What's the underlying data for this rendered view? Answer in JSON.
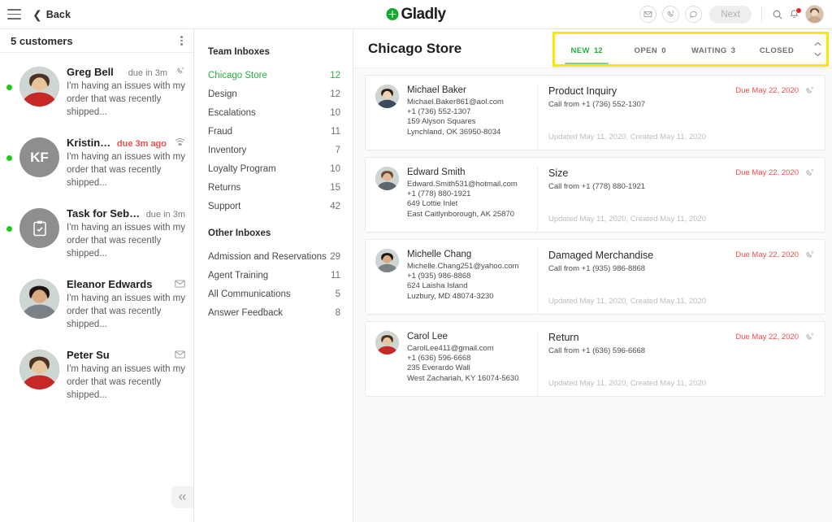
{
  "topbar": {
    "back_label": "Back",
    "brand_name": "Gladly",
    "next_label": "Next",
    "icons": [
      "envelope-icon",
      "phone-ring-icon",
      "chat-bubble-icon",
      "search-icon",
      "bell-icon"
    ]
  },
  "customers_pane": {
    "title": "5 customers",
    "items": [
      {
        "name": "Greg Bell",
        "due": "due in 3m",
        "overdue": false,
        "channel_icon": "phone-ring-icon",
        "snippet_line1": "I'm having an issues with my",
        "snippet_line2": "order that was recently shipped...",
        "avatar_type": "photo",
        "initials": "",
        "online": true
      },
      {
        "name": "Kristin Fisher",
        "due": "due 3m ago",
        "overdue": true,
        "channel_icon": "wifi-chat-icon",
        "snippet_line1": "I'm having an issues with my",
        "snippet_line2": "order that was recently shipped...",
        "avatar_type": "initials",
        "initials": "KF",
        "online": true
      },
      {
        "name": "Task for Sebasta...",
        "due": "due in 3m",
        "overdue": false,
        "channel_icon": "",
        "snippet_line1": "I'm having an issues with my",
        "snippet_line2": "order that was recently shipped...",
        "avatar_type": "task",
        "initials": "",
        "online": true
      },
      {
        "name": "Eleanor Edwards",
        "due": "",
        "overdue": false,
        "channel_icon": "envelope-icon",
        "snippet_line1": "I'm having an issues with my",
        "snippet_line2": "order that was recently shipped...",
        "avatar_type": "photo",
        "initials": "",
        "online": false
      },
      {
        "name": "Peter Su",
        "due": "",
        "overdue": false,
        "channel_icon": "envelope-icon",
        "snippet_line1": "I'm having an issues with my",
        "snippet_line2": "order that was recently shipped...",
        "avatar_type": "photo",
        "initials": "",
        "online": false
      }
    ]
  },
  "inbox_pane": {
    "team_title": "Team Inboxes",
    "team_items": [
      {
        "label": "Chicago Store",
        "count": "12",
        "active": true
      },
      {
        "label": "Design",
        "count": "12",
        "active": false
      },
      {
        "label": "Escalations",
        "count": "10",
        "active": false
      },
      {
        "label": "Fraud",
        "count": "11",
        "active": false
      },
      {
        "label": "Inventory",
        "count": "7",
        "active": false
      },
      {
        "label": "Loyalty Program",
        "count": "10",
        "active": false
      },
      {
        "label": "Returns",
        "count": "15",
        "active": false
      },
      {
        "label": "Support",
        "count": "42",
        "active": false
      }
    ],
    "other_title": "Other Inboxes",
    "other_items": [
      {
        "label": "Admission and Reservations",
        "count": "29",
        "active": false
      },
      {
        "label": "Agent Training",
        "count": "11",
        "active": false
      },
      {
        "label": "All Communications",
        "count": "5",
        "active": false
      },
      {
        "label": "Answer Feedback",
        "count": "8",
        "active": false
      }
    ]
  },
  "main": {
    "title": "Chicago Store",
    "tabs": [
      {
        "label": "NEW",
        "count": "12",
        "active": true
      },
      {
        "label": "OPEN",
        "count": "0",
        "active": false
      },
      {
        "label": "WAITING",
        "count": "3",
        "active": false
      },
      {
        "label": "CLOSED",
        "count": "",
        "active": false
      }
    ],
    "cards": [
      {
        "name": "Michael Baker",
        "email": "Michael.Baker861@aol.com",
        "phone": "+1 (736) 552-1307",
        "address1": "159 Alyson Squares",
        "address2": "Lynchland, OK 36950-8034",
        "topic": "Product Inquiry",
        "sub": "Call from +1 (736) 552-1307",
        "due": "Due May 22, 2020",
        "meta": "Updated May 11, 2020, Created May 11, 2020",
        "avatar_color": "#8a7463"
      },
      {
        "name": "Edward Smith",
        "email": "Edward.Smith531@hotmail.com",
        "phone": "+1 (778) 880-1921",
        "address1": "649 Lottie Inlet",
        "address2": "East Caitlynborough, AK 25870",
        "topic": "Size",
        "sub": "Call from +1 (778) 880-1921",
        "due": "Due May 22, 2020",
        "meta": "Updated May 11, 2020, Created May 11, 2020",
        "avatar_color": "#43352e"
      },
      {
        "name": "Michelle Chang",
        "email": "Michelle.Chang251@yahoo.com",
        "phone": "+1 (935) 986-8868",
        "address1": "624 Laisha Island",
        "address2": "Luzbury, MD 48074-3230",
        "topic": "Damaged Merchandise",
        "sub": "Call from +1 (935) 986-8868",
        "due": "Due May 22, 2020",
        "meta": "Updated May 11, 2020, Created May 11, 2020",
        "avatar_color": "#4a3a31"
      },
      {
        "name": "Carol Lee",
        "email": "CarolLee411@gmail.com",
        "phone": "+1 (636) 596-6668",
        "address1": "235 Everardo Wall",
        "address2": "West Zachariah, KY 16074-5630",
        "topic": "Return",
        "sub": "Call from +1 (636) 596-6668",
        "due": "Due May 22, 2020",
        "meta": "Updated May 11, 2020, Created May 11, 2020",
        "avatar_color": "#7a5a45"
      }
    ]
  },
  "colors": {
    "brand_green": "#0fab2e",
    "active_green": "#27ae3f",
    "due_red": "#ef4e4e",
    "highlight_yellow": "#ffe600",
    "status_dot": "#1ec91e"
  }
}
